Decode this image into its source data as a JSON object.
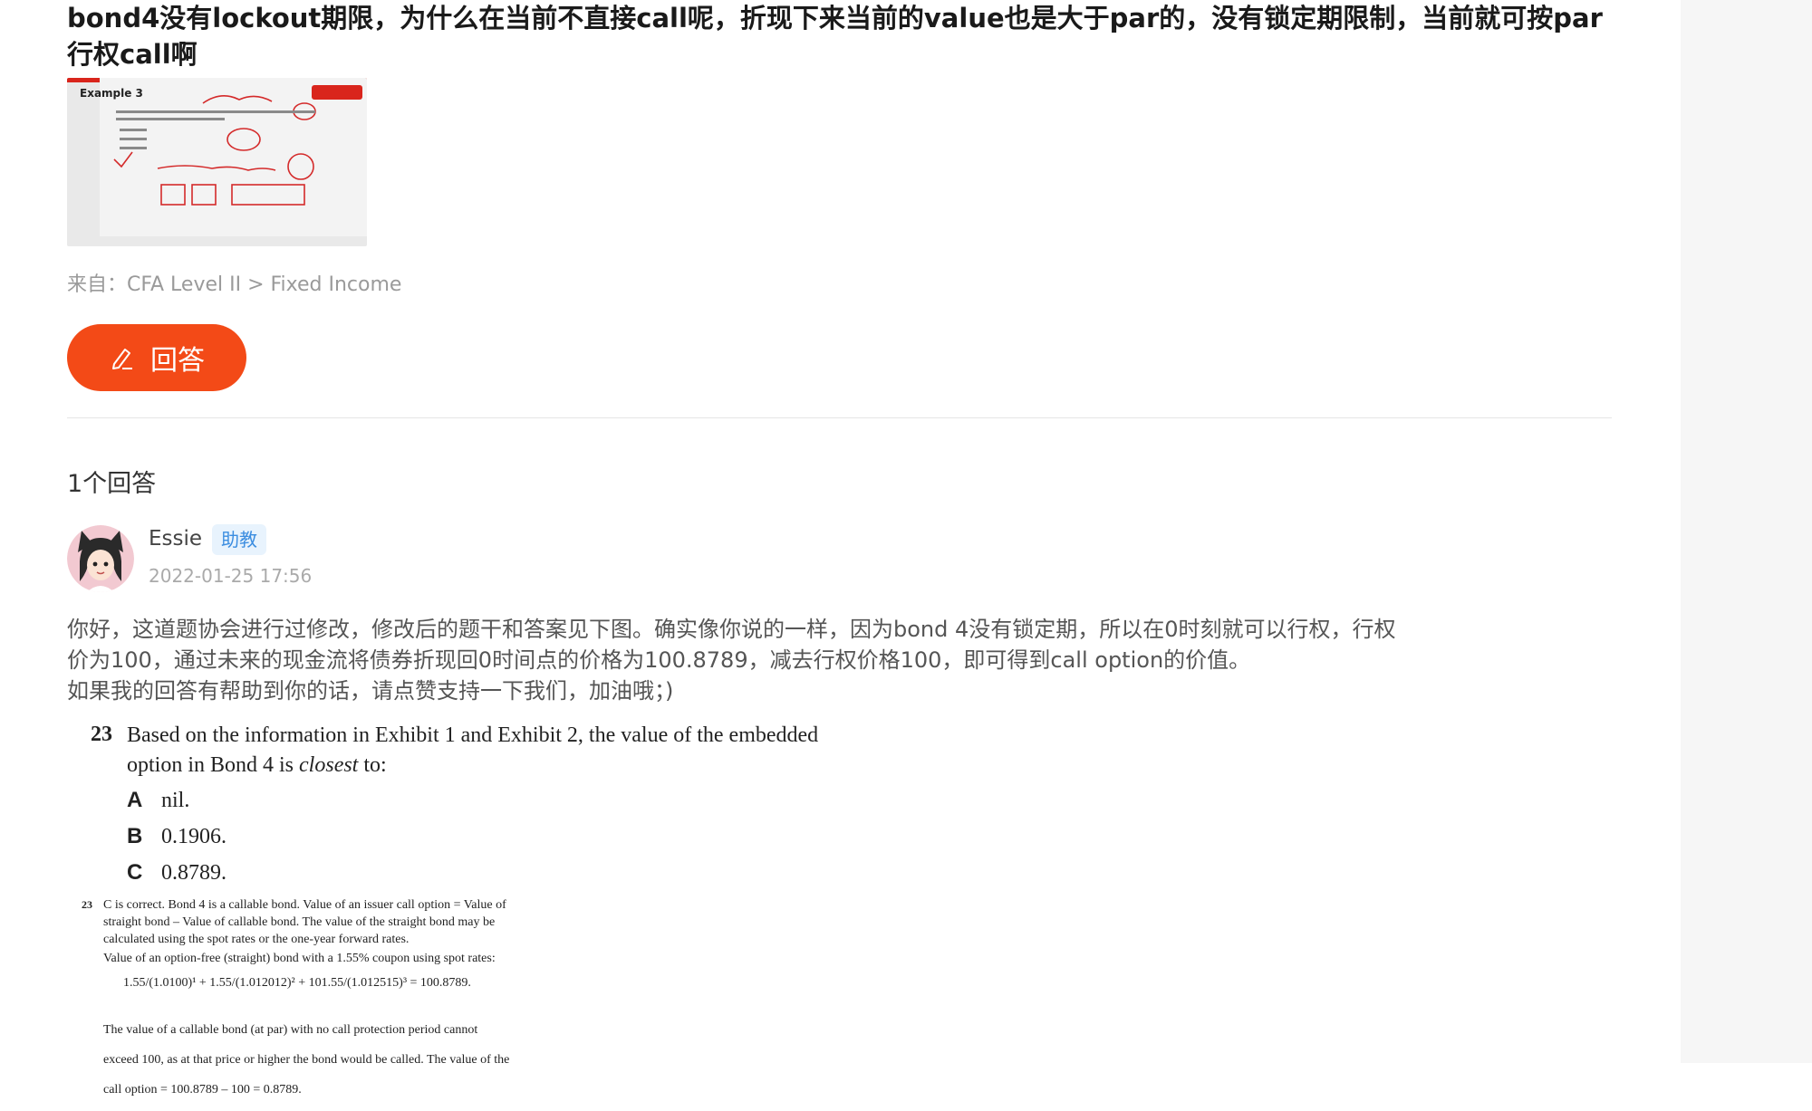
{
  "question": {
    "title": "bond4没有lockout期限，为什么在当前不直接call呢，折现下来当前的value也是大于par的，没有锁定期限制，当前就可按par行权call啊",
    "thumbnail": {
      "slide_title": "Example 3",
      "alt": "callable bond"
    },
    "source": "来自：CFA Level II > Fixed Income"
  },
  "answer_button": {
    "label": "回答",
    "icon": "pen-icon"
  },
  "answers": {
    "count_label": "1个回答",
    "items": [
      {
        "author": "Essie",
        "role": "助教",
        "time": "2022-01-25 17:56",
        "paragraphs": [
          "你好，这道题协会进行过修改，修改后的题干和答案见下图。确实像你说的一样，因为bond 4没有锁定期，所以在0时刻就可以行权，行权",
          "价为100，通过未来的现金流将债券折现回0时间点的价格为100.8789，减去行权价格100，即可得到call option的价值。",
          "如果我的回答有帮助到你的话，请点赞支持一下我们，加油哦；)"
        ],
        "image": {
          "q_number": "23",
          "stem_line1": "Based on the information in Exhibit 1 and Exhibit 2, the value of the embedded",
          "stem_line2_a": "option in Bond 4 is ",
          "stem_line2_em": "closest",
          "stem_line2_b": " to:",
          "options": [
            {
              "letter": "A",
              "text": "nil."
            },
            {
              "letter": "B",
              "text": "0.1906."
            },
            {
              "letter": "C",
              "text": "0.8789."
            }
          ],
          "sol_number": "23",
          "sol_lines": [
            "C is correct. Bond 4 is a callable bond. Value of an issuer call option = Value of",
            "straight bond – Value of callable bond. The value of the straight bond may be",
            "calculated using the spot rates or the one-year forward rates.",
            "Value of an option-free (straight) bond with a 1.55% coupon using spot rates:"
          ],
          "sol_eq": "1.55/(1.0100)¹ + 1.55/(1.012012)² + 101.55/(1.012515)³ = 100.8789.",
          "sol_tail": [
            "The value of a callable bond (at par) with no call protection period cannot",
            "exceed 100, as at that price or higher the bond would be called. The value of the",
            "call option = 100.8789 – 100 = 0.8789."
          ]
        }
      }
    ]
  },
  "colors": {
    "accent": "#f34a17",
    "badge_bg": "#e8f3fd",
    "badge_text": "#3b8de0"
  }
}
